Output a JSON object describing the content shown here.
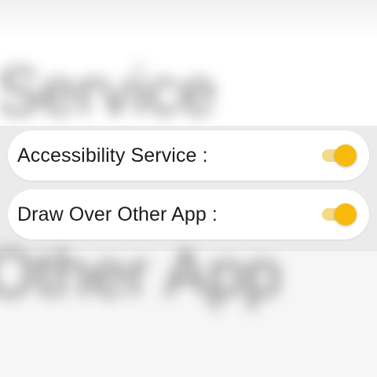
{
  "background": {
    "blurred_top_text": "y Service",
    "blurred_bottom_text": "Other App"
  },
  "settings": [
    {
      "label": "Accessibility Service :",
      "enabled": true
    },
    {
      "label": "Draw Over Other App :",
      "enabled": true
    }
  ],
  "colors": {
    "accent": "#f8bb0d",
    "track": "#f4d987",
    "card": "#ffffff"
  },
  "icons": {
    "toggle": "toggle-switch-on"
  }
}
